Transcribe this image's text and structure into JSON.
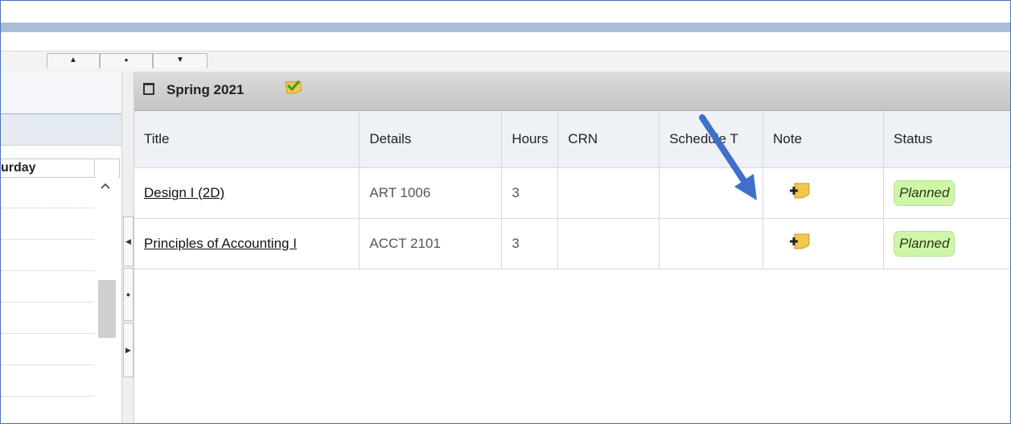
{
  "toolbar": {
    "up_glyph": "▲",
    "dot_glyph": "●",
    "down_glyph": "▼"
  },
  "left_pane": {
    "day_label": "urday"
  },
  "term": {
    "title": "Spring 2021",
    "check_color": "#2e9e2e"
  },
  "table": {
    "headers": [
      "Title",
      "Details",
      "Hours",
      "CRN",
      "Schedule T",
      "Note",
      "Status"
    ],
    "rows": [
      {
        "title": "Design I (2D)",
        "details": "ART 1006",
        "hours": "3",
        "crn": "",
        "schedule": "",
        "status": "Planned"
      },
      {
        "title": "Principles of Accounting I",
        "details": "ACCT 2101",
        "hours": "3",
        "crn": "",
        "schedule": "",
        "status": "Planned"
      }
    ]
  },
  "colors": {
    "accent": "#4a74b8",
    "status_bg": "#cff5a8",
    "arrow": "#3f6fc9"
  }
}
